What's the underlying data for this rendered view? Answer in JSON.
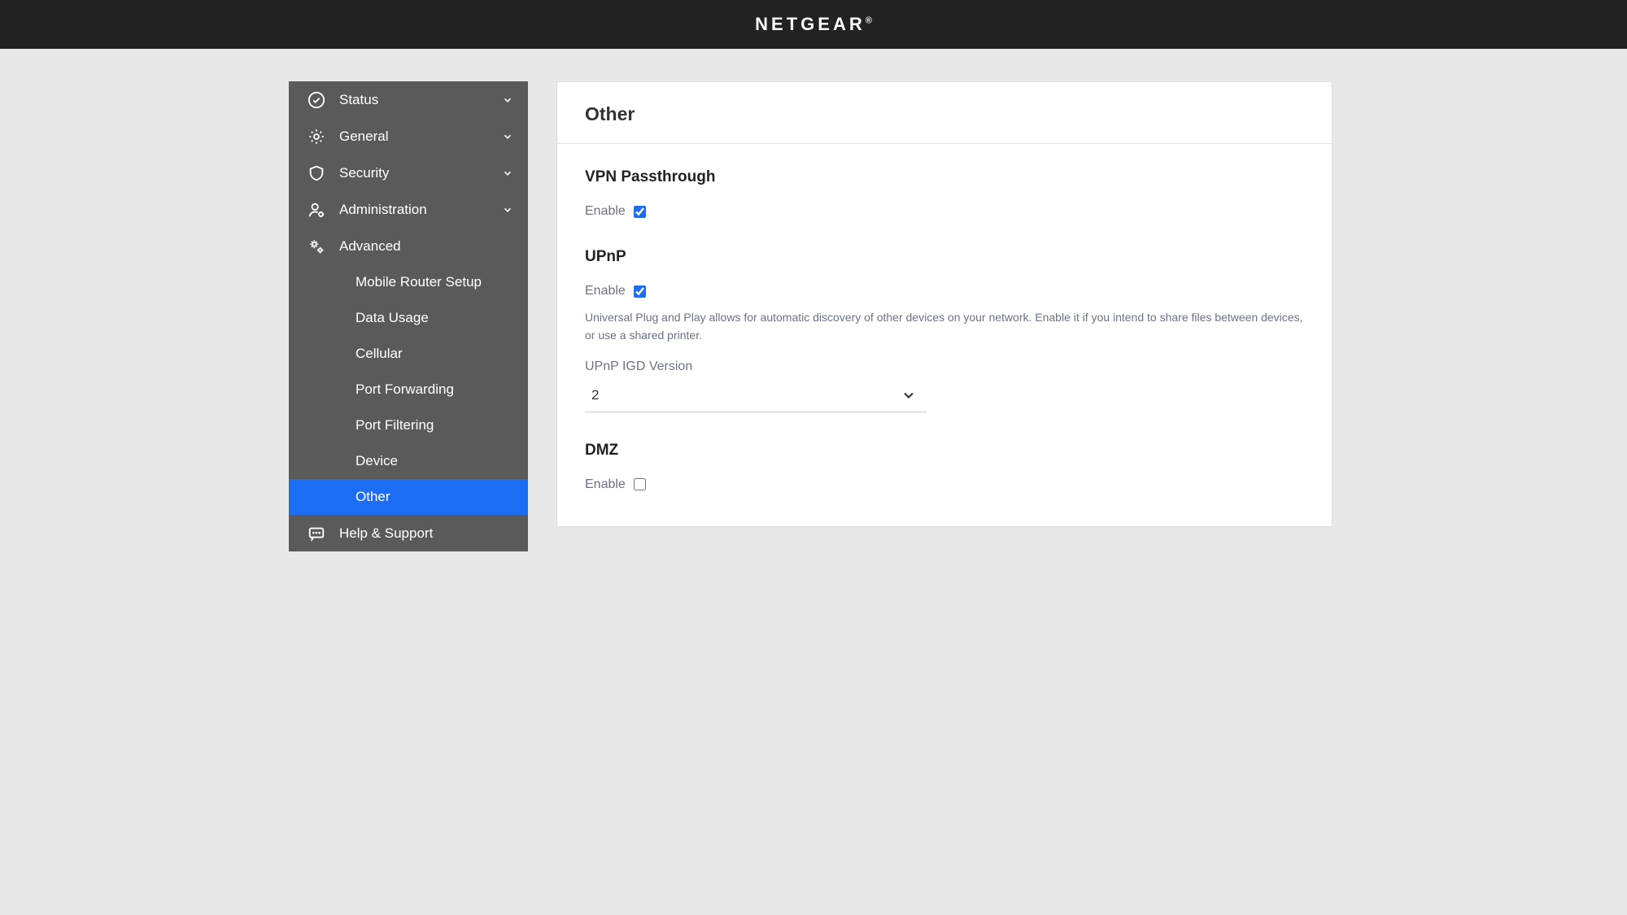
{
  "header": {
    "brand": "NETGEAR"
  },
  "sidebar": {
    "items": [
      {
        "label": "Status"
      },
      {
        "label": "General"
      },
      {
        "label": "Security"
      },
      {
        "label": "Administration"
      },
      {
        "label": "Advanced"
      }
    ],
    "advanced_sub": [
      {
        "label": "Mobile Router Setup"
      },
      {
        "label": "Data Usage"
      },
      {
        "label": "Cellular"
      },
      {
        "label": "Port Forwarding"
      },
      {
        "label": "Port Filtering"
      },
      {
        "label": "Device"
      },
      {
        "label": "Other"
      }
    ],
    "footer": {
      "label": "Help & Support"
    }
  },
  "page": {
    "title": "Other",
    "vpn": {
      "heading": "VPN Passthrough",
      "enable_label": "Enable",
      "enabled": true
    },
    "upnp": {
      "heading": "UPnP",
      "enable_label": "Enable",
      "enabled": true,
      "desc": "Universal Plug and Play allows for automatic discovery of other devices on your network. Enable it if you intend to share files between devices, or use a shared printer.",
      "version_label": "UPnP IGD Version",
      "version_value": "2"
    },
    "dmz": {
      "heading": "DMZ",
      "enable_label": "Enable",
      "enabled": false
    }
  }
}
